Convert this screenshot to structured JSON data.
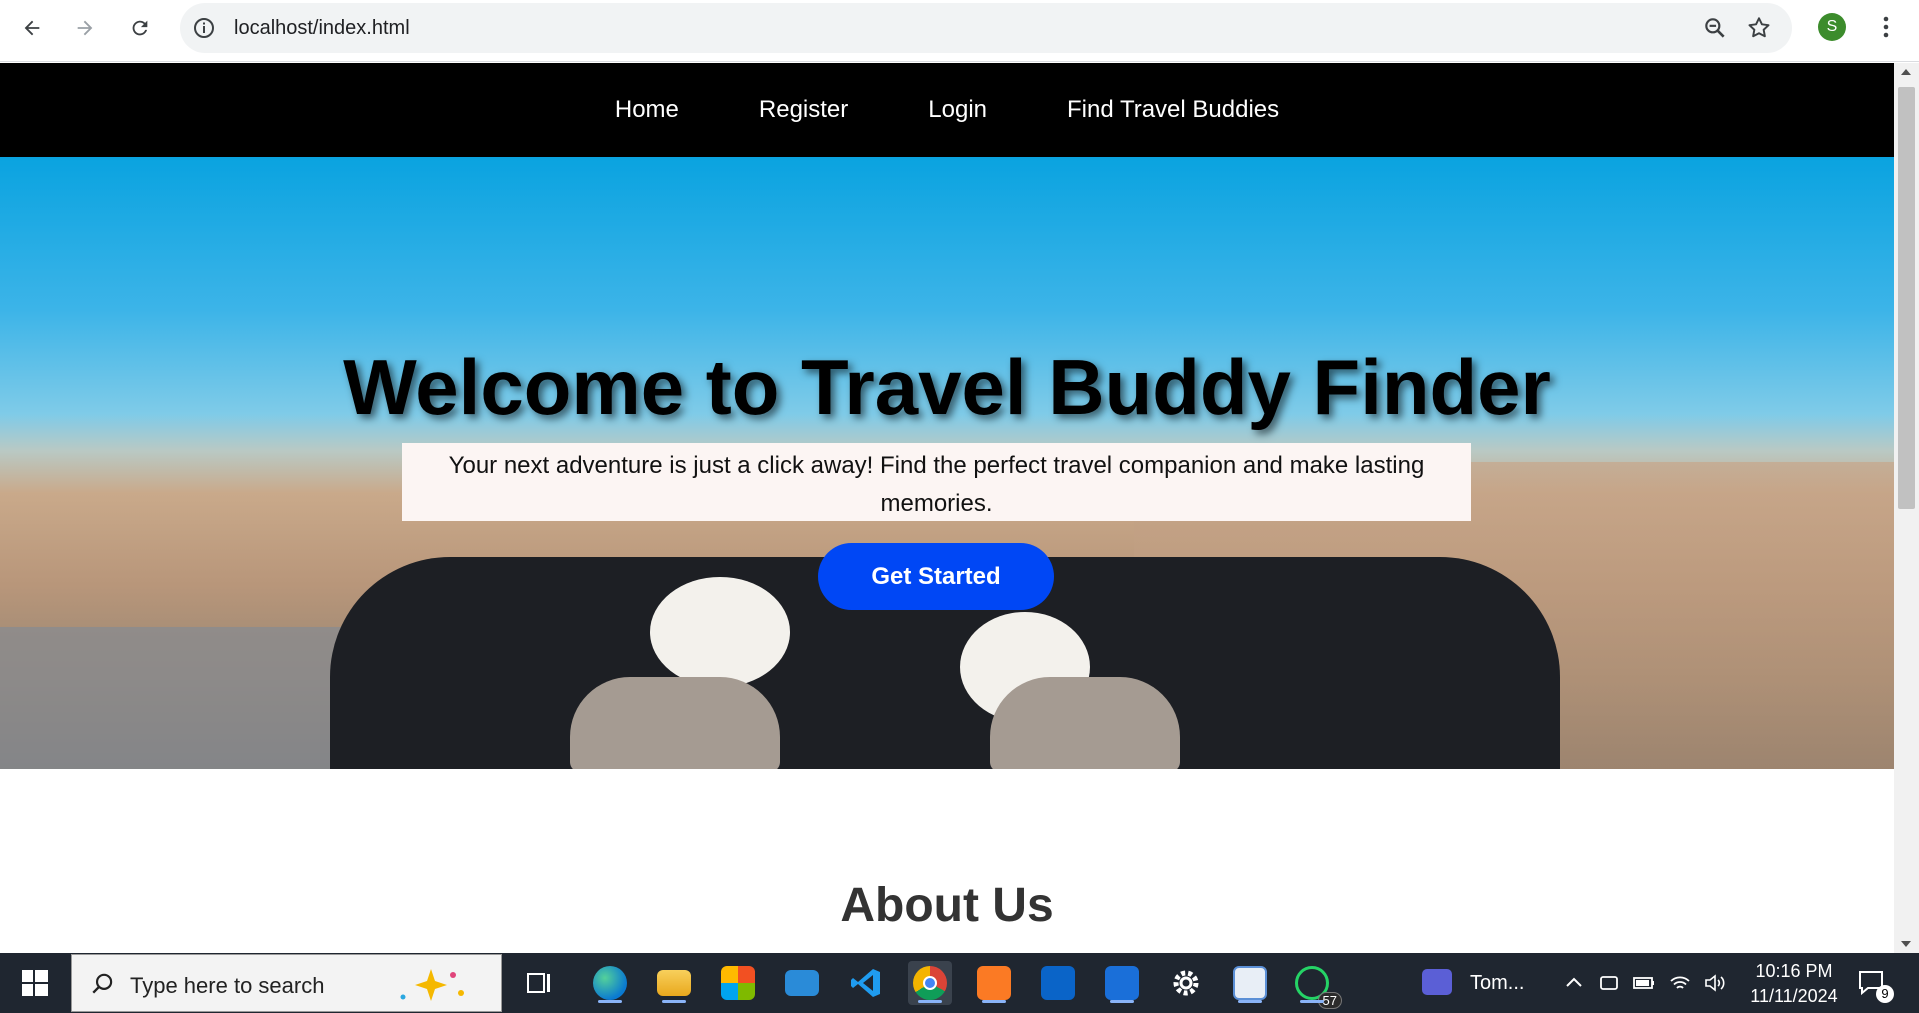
{
  "browser": {
    "url": "localhost/index.html",
    "profile_initial": "S"
  },
  "site": {
    "nav": [
      "Home",
      "Register",
      "Login",
      "Find Travel Buddies"
    ],
    "hero_title": "Welcome to Travel Buddy Finder",
    "hero_subtitle": "Your next adventure is just a click away! Find the perfect travel companion and make lasting memories.",
    "cta_label": "Get Started",
    "about_title": "About Us"
  },
  "taskbar": {
    "search_placeholder": "Type here to search",
    "whatsapp_badge": "57",
    "zoom_label": "Tom...",
    "time": "10:16 PM",
    "date": "11/11/2024",
    "notification_count": "9"
  },
  "colors": {
    "nav_bg": "#000000",
    "cta_bg": "#0047f5",
    "taskbar_bg": "#1f2630",
    "profile_bg": "#3c8c2c"
  }
}
